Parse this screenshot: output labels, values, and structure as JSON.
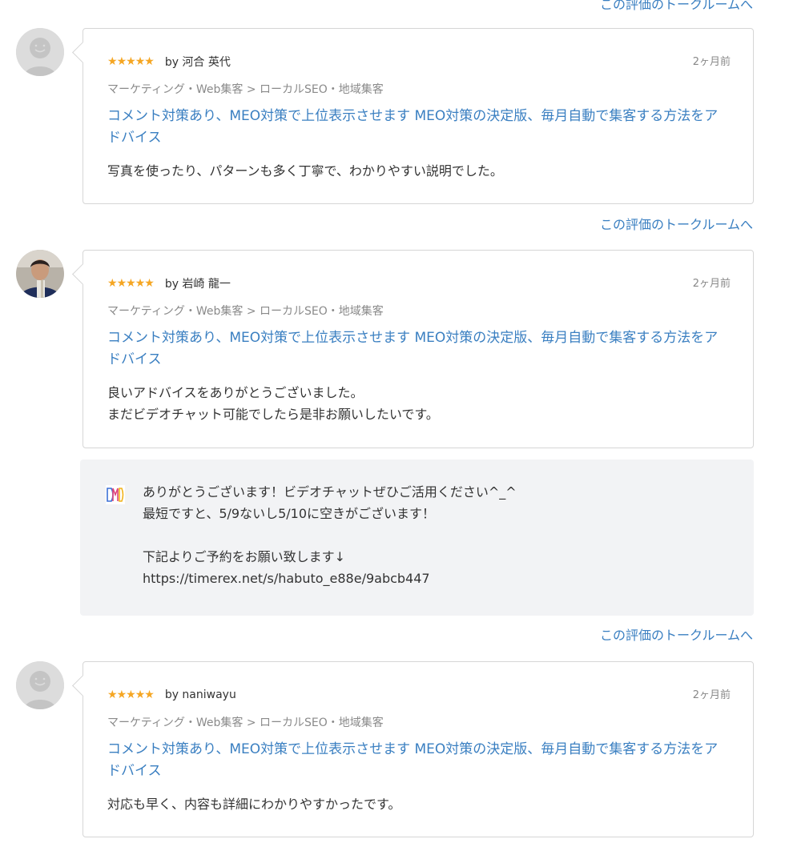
{
  "talkroom_link_label": "この評価のトークルームへ",
  "reviews": [
    {
      "reviewer": "by 河合 英代",
      "date": "2ヶ月前",
      "rating": 5,
      "category": "マーケティング・Web集客 > ローカルSEO・地域集客",
      "service_title_line1": "コメント対策あり、MEO対策で上位表示させます MEO対策の決定版、毎月自動で集客する方法をア",
      "service_title_line2": "ドバイス",
      "comment_lines": [
        "写真を使ったり、パターンも多く丁寧で、わかりやすい説明でした。"
      ],
      "avatar": "default-user-icon"
    },
    {
      "reviewer": "by 岩崎 龍一",
      "date": "2ヶ月前",
      "rating": 5,
      "category": "マーケティング・Web集客 > ローカルSEO・地域集客",
      "service_title_line1": "コメント対策あり、MEO対策で上位表示させます MEO対策の決定版、毎月自動で集客する方法をア",
      "service_title_line2": "ドバイス",
      "comment_lines": [
        "良いアドバイスをありがとうございました。",
        "まだビデオチャット可能でしたら是非お願いしたいです。"
      ],
      "avatar": "user-photo",
      "reply": {
        "lines": [
          "ありがとうございます！ビデオチャットぜひご活用ください^_^",
          "最短ですと、5/9ないし5/10に空きがございます！",
          "",
          "下記よりご予約をお願い致します↓",
          "https://timerex.net/s/habuto_e88e/9abcb447"
        ]
      }
    },
    {
      "reviewer": "by naniwayu",
      "date": "2ヶ月前",
      "rating": 5,
      "category": "マーケティング・Web集客 > ローカルSEO・地域集客",
      "service_title_line1": "コメント対策あり、MEO対策で上位表示させます MEO対策の決定版、毎月自動で集客する方法をア",
      "service_title_line2": "ドバイス",
      "comment_lines": [
        "対応も早く、内容も詳細にわかりやすかったです。"
      ],
      "avatar": "default-user-icon"
    }
  ],
  "colors": {
    "link": "#3a7fc1",
    "star": "#f5a623",
    "reply_bg": "#f2f3f5"
  }
}
